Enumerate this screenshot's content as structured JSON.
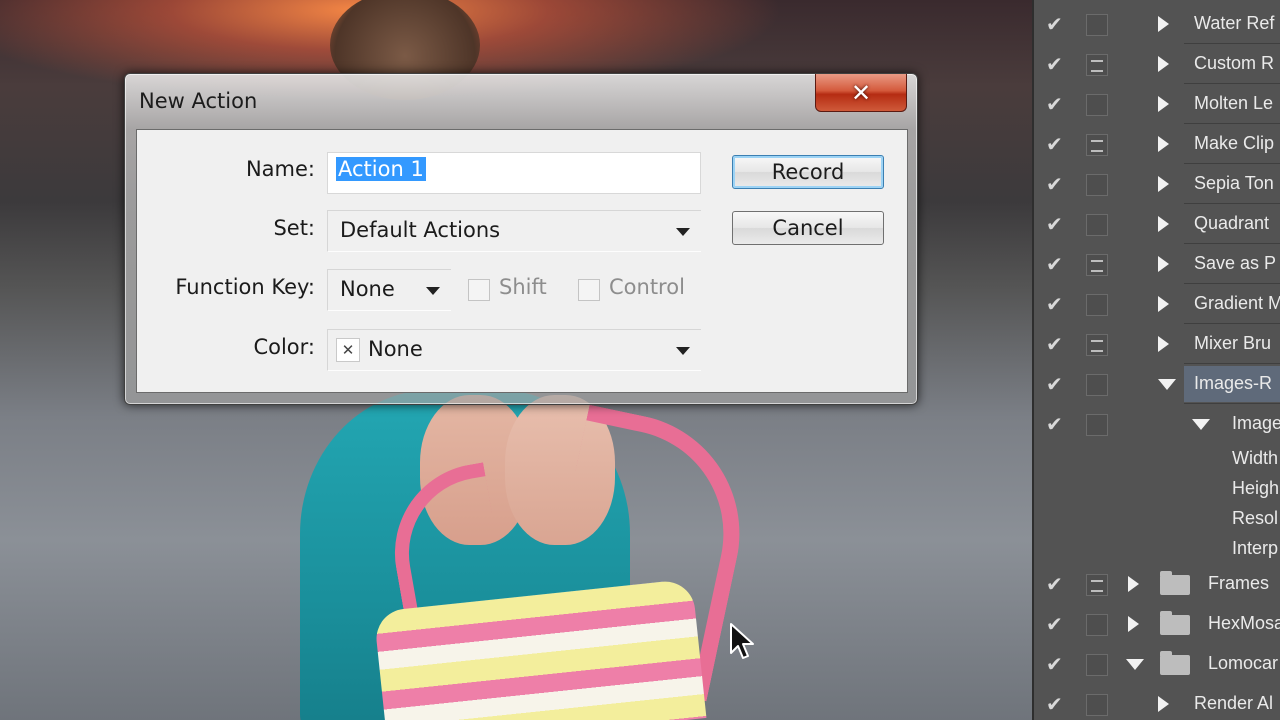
{
  "dialog": {
    "title": "New Action",
    "close_glyph": "✕",
    "name_label": "Name:",
    "name_value": "Action 1",
    "set_label": "Set:",
    "set_value": "Default Actions",
    "function_key_label": "Function Key:",
    "function_key_value": "None",
    "shift_label": "Shift",
    "control_label": "Control",
    "color_label": "Color:",
    "color_value": "None",
    "color_swatch_glyph": "✕",
    "record_label": "Record",
    "cancel_label": "Cancel"
  },
  "actions_panel": {
    "rows": [
      {
        "label": "Water Ref",
        "dialog": false,
        "expanded": false
      },
      {
        "label": "Custom R",
        "dialog": true,
        "expanded": false
      },
      {
        "label": "Molten Le",
        "dialog": false,
        "expanded": false
      },
      {
        "label": "Make Clip",
        "dialog": true,
        "expanded": false
      },
      {
        "label": "Sepia Ton",
        "dialog": false,
        "expanded": false
      },
      {
        "label": "Quadrant",
        "dialog": false,
        "expanded": false
      },
      {
        "label": "Save as P",
        "dialog": true,
        "expanded": false
      },
      {
        "label": "Gradient M",
        "dialog": false,
        "expanded": false
      },
      {
        "label": "Mixer Bru",
        "dialog": true,
        "expanded": false
      },
      {
        "label": "Images-R",
        "dialog": false,
        "expanded": true,
        "selected": true
      },
      {
        "label": "Image",
        "dialog": false,
        "expanded": true
      }
    ],
    "sub_items": [
      "Width",
      "Heigh",
      "Resol",
      "Interp"
    ],
    "folders": [
      {
        "label": "Frames",
        "dialog": true,
        "expanded": false
      },
      {
        "label": "HexMosa",
        "dialog": false,
        "expanded": false
      },
      {
        "label": "Lomocar",
        "dialog": false,
        "expanded": true
      }
    ],
    "last_row": "Render Al"
  },
  "colors": {
    "selection": "#3399ff",
    "panel_bg": "#535353",
    "close_red": "#c7432a"
  }
}
